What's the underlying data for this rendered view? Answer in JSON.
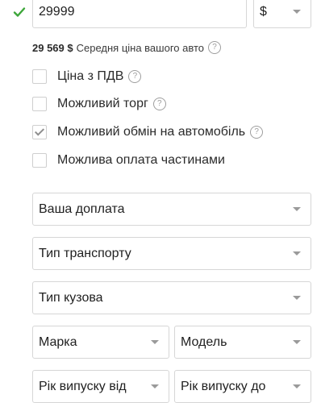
{
  "price": {
    "value": "29999",
    "currency": "$"
  },
  "average": {
    "amount": "29 569 $",
    "text": "Середня ціна вашого авто"
  },
  "help_glyph": "?",
  "options": [
    {
      "label": "Ціна з ПДВ",
      "checked": false
    },
    {
      "label": "Можливий торг",
      "checked": false
    },
    {
      "label": "Можливий обмін на автомобіль",
      "checked": true
    },
    {
      "label": "Можлива оплата частинами",
      "checked": false
    }
  ],
  "selects": {
    "surcharge": "Ваша доплата",
    "transport_type": "Тип транспорту",
    "body_type": "Тип кузова",
    "brand": "Марка",
    "model": "Модель",
    "year_from": "Рік випуску від",
    "year_to": "Рік випуску до"
  },
  "colors": {
    "valid_check": "#3da63a",
    "border": "#d6d6d6",
    "caret": "#9a9a9a"
  }
}
